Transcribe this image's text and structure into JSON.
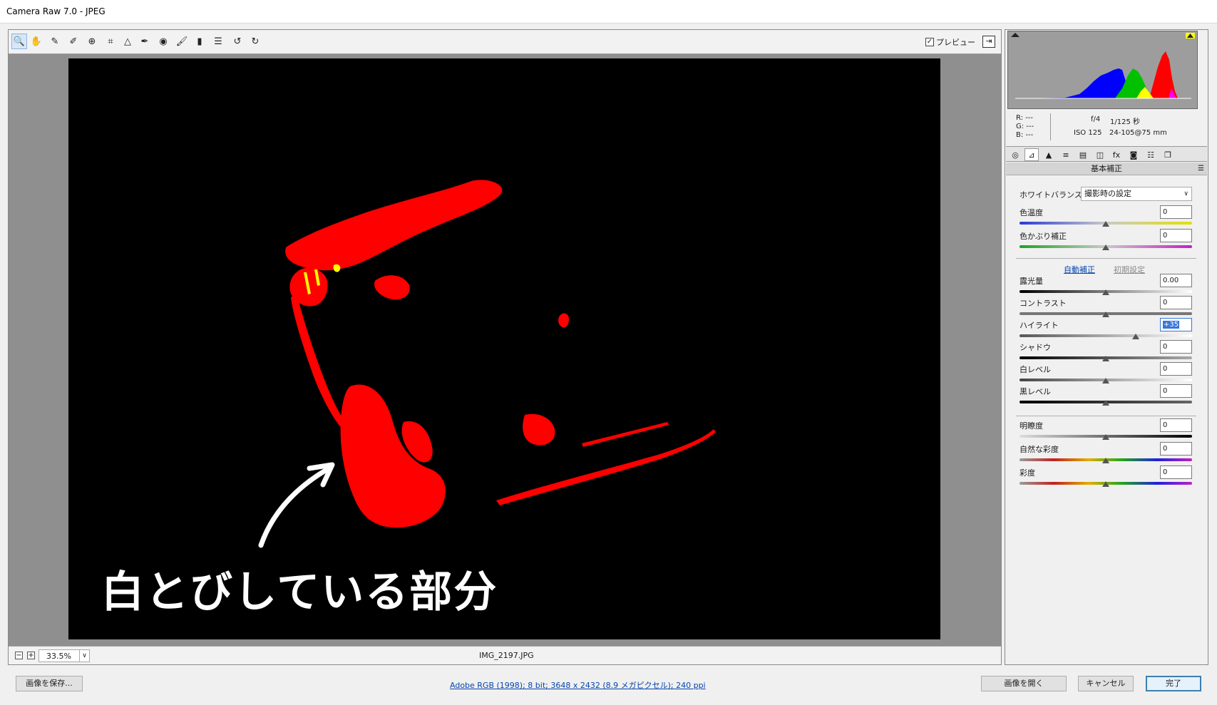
{
  "window": {
    "title": "Camera Raw 7.0  -  JPEG"
  },
  "toolbar": {
    "tools": [
      {
        "name": "zoom-tool",
        "icon": "🔍"
      },
      {
        "name": "hand-tool",
        "icon": "✋"
      },
      {
        "name": "white-balance-tool",
        "icon": "✎"
      },
      {
        "name": "color-sampler-tool",
        "icon": "✐"
      },
      {
        "name": "targeted-adjustment-tool",
        "icon": "⊕"
      },
      {
        "name": "crop-tool",
        "icon": "⌗"
      },
      {
        "name": "straighten-tool",
        "icon": "△"
      },
      {
        "name": "spot-removal-tool",
        "icon": "✒"
      },
      {
        "name": "red-eye-tool",
        "icon": "◉"
      },
      {
        "name": "adjustment-brush-tool",
        "icon": "🖌"
      },
      {
        "name": "graduated-filter-tool",
        "icon": "▮"
      },
      {
        "name": "preferences-tool",
        "icon": "☰"
      },
      {
        "name": "rotate-ccw-tool",
        "icon": "↺"
      },
      {
        "name": "rotate-cw-tool",
        "icon": "↻"
      }
    ],
    "preview_label": "プレビュー",
    "preview_checked": true
  },
  "image": {
    "annotation": "白とびしている部分",
    "clip_color": "#ff0000"
  },
  "status": {
    "zoom": "33.5%",
    "filename": "IMG_2197.JPG"
  },
  "readouts": {
    "r": "R:  ---",
    "g": "G:  ---",
    "b": "B:  ---",
    "aperture": "f/4",
    "shutter": "1/125 秒",
    "iso": "ISO 125",
    "lens": "24-105@75 mm"
  },
  "panel": {
    "title": "基本補正",
    "wb_label": "ホワイトバランス :",
    "wb_value": "撮影時の設定",
    "auto_link": "自動補正",
    "default_link": "初期設定",
    "sliders": [
      {
        "key": "temp",
        "label": "色温度",
        "value": "0",
        "pos": 0.5
      },
      {
        "key": "tint",
        "label": "色かぶり補正",
        "value": "0",
        "pos": 0.5
      },
      {
        "key": "exposure",
        "label": "露光量",
        "value": "0.00",
        "pos": 0.5
      },
      {
        "key": "contrast",
        "label": "コントラスト",
        "value": "0",
        "pos": 0.5
      },
      {
        "key": "highlights",
        "label": "ハイライト",
        "value": "+35",
        "pos": 0.675
      },
      {
        "key": "shadows",
        "label": "シャドウ",
        "value": "0",
        "pos": 0.5
      },
      {
        "key": "whites",
        "label": "白レベル",
        "value": "0",
        "pos": 0.5
      },
      {
        "key": "blacks",
        "label": "黒レベル",
        "value": "0",
        "pos": 0.5
      },
      {
        "key": "clarity",
        "label": "明瞭度",
        "value": "0",
        "pos": 0.5
      },
      {
        "key": "vibrance",
        "label": "自然な彩度",
        "value": "0",
        "pos": 0.5
      },
      {
        "key": "saturation",
        "label": "彩度",
        "value": "0",
        "pos": 0.5
      }
    ]
  },
  "footer": {
    "save_label": "画像を保存...",
    "info": "Adobe RGB (1998); 8 bit; 3648 x 2432 (8.9 メガピクセル); 240 ppi",
    "open_label": "画像を開く",
    "cancel_label": "キャンセル",
    "done_label": "完了"
  }
}
